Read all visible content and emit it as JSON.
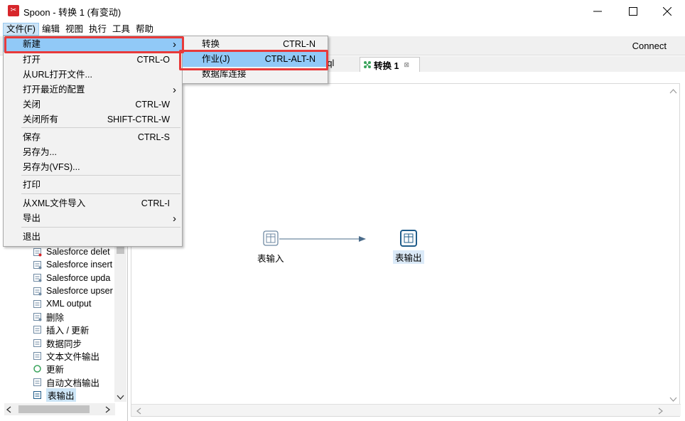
{
  "window": {
    "title": "Spoon - 转换 1 (有变动)",
    "app_icon_glyph": "✂"
  },
  "menubar": {
    "items": [
      "文件(F)",
      "编辑",
      "视图",
      "执行",
      "工具",
      "帮助"
    ]
  },
  "toolbar": {
    "connect_label": "Connect"
  },
  "tabs": {
    "partial_label": "ysql",
    "active_label": "转换 1",
    "close_glyph": "⊠"
  },
  "file_menu": {
    "items": [
      {
        "label": "新建",
        "shortcut": "",
        "submenu": true
      },
      {
        "label": "打开",
        "shortcut": "CTRL-O",
        "submenu": false
      },
      {
        "label": "从URL打开文件...",
        "shortcut": "",
        "submenu": false
      },
      {
        "label": "打开最近的配置",
        "shortcut": "",
        "submenu": true
      },
      {
        "label": "关闭",
        "shortcut": "CTRL-W",
        "submenu": false
      },
      {
        "label": "关闭所有",
        "shortcut": "SHIFT-CTRL-W",
        "submenu": false
      },
      {
        "label": "保存",
        "shortcut": "CTRL-S",
        "submenu": false
      },
      {
        "label": "另存为...",
        "shortcut": "",
        "submenu": false
      },
      {
        "label": "另存为(VFS)...",
        "shortcut": "",
        "submenu": false
      },
      {
        "label": "打印",
        "shortcut": "",
        "submenu": false
      },
      {
        "label": "从XML文件导入",
        "shortcut": "CTRL-I",
        "submenu": false
      },
      {
        "label": "导出",
        "shortcut": "",
        "submenu": true
      },
      {
        "label": "退出",
        "shortcut": "",
        "submenu": false
      }
    ]
  },
  "new_submenu": {
    "items": [
      {
        "label": "转换",
        "shortcut": "CTRL-N"
      },
      {
        "label": "作业(J)",
        "shortcut": "CTRL-ALT-N"
      },
      {
        "label": "数据库连接",
        "shortcut": ""
      }
    ]
  },
  "tree": {
    "items": [
      {
        "label": "Salesforce delet",
        "icon": "salesforce-delete-icon"
      },
      {
        "label": "Salesforce insert",
        "icon": "salesforce-insert-icon"
      },
      {
        "label": "Salesforce upda",
        "icon": "salesforce-update-icon"
      },
      {
        "label": "Salesforce upser",
        "icon": "salesforce-upsert-icon"
      },
      {
        "label": "XML output",
        "icon": "xml-output-icon"
      },
      {
        "label": "删除",
        "icon": "delete-step-icon"
      },
      {
        "label": "插入 / 更新",
        "icon": "insert-update-icon"
      },
      {
        "label": "数据同步",
        "icon": "synchronize-icon"
      },
      {
        "label": "文本文件输出",
        "icon": "text-file-output-icon"
      },
      {
        "label": "更新",
        "icon": "update-icon"
      },
      {
        "label": "自动文档输出",
        "icon": "auto-doc-output-icon"
      },
      {
        "label": "表输出",
        "icon": "table-output-icon"
      }
    ]
  },
  "canvas": {
    "step_input_label": "表输入",
    "step_output_label": "表输出"
  },
  "colors": {
    "highlight_red": "#e83a3a",
    "menu_highlight": "#91c9f7",
    "brand_red": "#d7262b",
    "hop_color": "#4a6b8a"
  }
}
